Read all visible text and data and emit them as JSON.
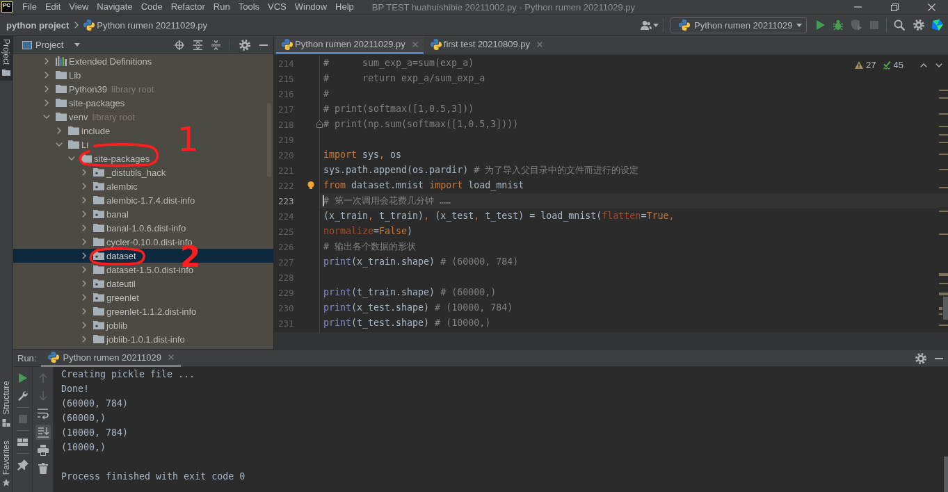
{
  "title_bar": {
    "logo": "PC",
    "menu": [
      "File",
      "Edit",
      "View",
      "Navigate",
      "Code",
      "Refactor",
      "Run",
      "Tools",
      "VCS",
      "Window",
      "Help"
    ],
    "title": "BP TEST huahuishibie 20211002.py - Python rumen 20211029.py"
  },
  "nav_bar": {
    "project": "python project",
    "file": "Python rumen 20211029.py",
    "run_config": "Python rumen 20211029",
    "stop": {
      "disabled": true
    }
  },
  "tool_strip": {
    "tabs": [
      {
        "label": "Project",
        "selected": true
      },
      {
        "label": "Structure",
        "selected": false
      },
      {
        "label": "Favorites",
        "selected": false
      }
    ]
  },
  "project_panel": {
    "title": "Project",
    "tree": [
      {
        "label": "Extended Definitions",
        "kind": "library",
        "expanded": false,
        "selected": false
      },
      {
        "label": "Lib",
        "kind": "folder",
        "expanded": false,
        "selected": false
      },
      {
        "label": "Python39",
        "note": "library root",
        "kind": "folder",
        "expanded": false,
        "selected": false
      },
      {
        "label": "site-packages",
        "kind": "folder",
        "expanded": false,
        "selected": false
      },
      {
        "label": "venv",
        "note": "library root",
        "kind": "folder",
        "expanded": true,
        "selected": false,
        "children": [
          {
            "label": "include",
            "kind": "folder",
            "expanded": false,
            "selected": false
          },
          {
            "label": "Li",
            "kind": "folder",
            "expanded": true,
            "selected": false,
            "children": [
              {
                "label": "site-packages",
                "kind": "folder",
                "expanded": true,
                "selected": false,
                "children": [
                  {
                    "label": "_distutils_hack",
                    "kind": "package",
                    "expanded": false,
                    "selected": false
                  },
                  {
                    "label": "alembic",
                    "kind": "package",
                    "expanded": false,
                    "selected": false
                  },
                  {
                    "label": "alembic-1.7.4.dist-info",
                    "kind": "folder",
                    "expanded": false,
                    "selected": false
                  },
                  {
                    "label": "banal",
                    "kind": "package",
                    "expanded": false,
                    "selected": false
                  },
                  {
                    "label": "banal-1.0.6.dist-info",
                    "kind": "folder",
                    "expanded": false,
                    "selected": false
                  },
                  {
                    "label": "cycler-0.10.0.dist-info",
                    "kind": "folder",
                    "expanded": false,
                    "selected": false
                  },
                  {
                    "label": "dataset",
                    "kind": "package",
                    "expanded": false,
                    "selected": true
                  },
                  {
                    "label": "dataset-1.5.0.dist-info",
                    "kind": "folder",
                    "expanded": false,
                    "selected": false
                  },
                  {
                    "label": "dateutil",
                    "kind": "package",
                    "expanded": false,
                    "selected": false
                  },
                  {
                    "label": "greenlet",
                    "kind": "package",
                    "expanded": false,
                    "selected": false
                  },
                  {
                    "label": "greenlet-1.1.2.dist-info",
                    "kind": "folder",
                    "expanded": false,
                    "selected": false
                  },
                  {
                    "label": "joblib",
                    "kind": "package",
                    "expanded": false,
                    "selected": false
                  },
                  {
                    "label": "joblib-1.0.1.dist-info",
                    "kind": "folder",
                    "expanded": false,
                    "selected": false
                  }
                ]
              }
            ]
          }
        ]
      }
    ]
  },
  "annotations": [
    {
      "label": "1"
    },
    {
      "label": "2"
    }
  ],
  "editor": {
    "tabs": [
      {
        "label": "Python rumen 20211029.py",
        "selected": true
      },
      {
        "label": "first test 20210809.py",
        "selected": false
      }
    ],
    "inspections": {
      "warnings": "27",
      "weak_warnings": "45"
    },
    "lines": [
      {
        "number": "214",
        "current": false,
        "fold_end": false,
        "bulb": false,
        "tokens": [
          {
            "kind": "comment",
            "text": "#      sum_exp_a=sum(exp_a)"
          }
        ]
      },
      {
        "number": "215",
        "current": false,
        "fold_end": false,
        "bulb": false,
        "tokens": [
          {
            "kind": "comment",
            "text": "#      return exp_a/sum_exp_a"
          }
        ]
      },
      {
        "number": "216",
        "current": false,
        "fold_end": false,
        "bulb": false,
        "tokens": [
          {
            "kind": "comment",
            "text": "#"
          }
        ]
      },
      {
        "number": "217",
        "current": false,
        "fold_end": false,
        "bulb": false,
        "tokens": [
          {
            "kind": "comment",
            "text": "# print(softmax([1,0.5,3]))"
          }
        ]
      },
      {
        "number": "218",
        "current": false,
        "fold_end": true,
        "bulb": false,
        "tokens": [
          {
            "kind": "comment",
            "text": "# print(np.sum(softmax([1,0.5,3])))"
          }
        ]
      },
      {
        "number": "219",
        "current": false,
        "fold_end": false,
        "bulb": false
      },
      {
        "number": "220",
        "current": false,
        "fold_end": false,
        "bulb": false,
        "tokens": [
          {
            "kind": "keyword",
            "text": "import"
          },
          {
            "kind": "plain",
            "text": " sys"
          },
          {
            "kind": "keyword",
            "text": ","
          },
          {
            "kind": "plain",
            "text": " os"
          }
        ]
      },
      {
        "number": "221",
        "current": false,
        "fold_end": false,
        "bulb": false,
        "tokens": [
          {
            "kind": "plain",
            "text": "sys.path.append(os.pardir)"
          },
          {
            "kind": "comment",
            "text": " # 为了导入父目录中的文件而进行的设定"
          }
        ]
      },
      {
        "number": "222",
        "current": false,
        "fold_end": false,
        "bulb": true,
        "tokens": [
          {
            "kind": "keyword",
            "text": "from"
          },
          {
            "kind": "plain",
            "text": " dataset.mnist "
          },
          {
            "kind": "keyword",
            "text": "import"
          },
          {
            "kind": "plain",
            "text": " load_mnist"
          }
        ]
      },
      {
        "number": "223",
        "current": true,
        "fold_end": false,
        "bulb": false,
        "tokens": [
          {
            "kind": "comment",
            "text": "# 第一次调用会花费几分钟 ……"
          }
        ]
      },
      {
        "number": "224",
        "current": false,
        "fold_end": false,
        "bulb": false,
        "tokens": [
          {
            "kind": "plain",
            "text": "(x_train"
          },
          {
            "kind": "keyword",
            "text": ","
          },
          {
            "kind": "plain",
            "text": " t_train)"
          },
          {
            "kind": "keyword",
            "text": ","
          },
          {
            "kind": "plain",
            "text": " (x_test"
          },
          {
            "kind": "keyword",
            "text": ","
          },
          {
            "kind": "plain",
            "text": " t_test) = load_mnist("
          },
          {
            "kind": "param",
            "text": "flatten"
          },
          {
            "kind": "plain",
            "text": "="
          },
          {
            "kind": "keyword",
            "text": "True,"
          }
        ]
      },
      {
        "number": "225",
        "current": false,
        "fold_end": false,
        "bulb": false,
        "tokens": [
          {
            "kind": "param",
            "text": "normalize"
          },
          {
            "kind": "plain",
            "text": "="
          },
          {
            "kind": "keyword",
            "text": "False"
          },
          {
            "kind": "plain",
            "text": ")"
          }
        ]
      },
      {
        "number": "226",
        "current": false,
        "fold_end": false,
        "bulb": false,
        "tokens": [
          {
            "kind": "comment",
            "text": "# 输出各个数据的形状"
          }
        ]
      },
      {
        "number": "227",
        "current": false,
        "fold_end": false,
        "bulb": false,
        "tokens": [
          {
            "kind": "builtin",
            "text": "print"
          },
          {
            "kind": "plain",
            "text": "(x_train.shape)"
          },
          {
            "kind": "comment",
            "text": " # (60000, 784)"
          }
        ]
      },
      {
        "number": "228",
        "current": false,
        "fold_end": false,
        "bulb": false
      },
      {
        "number": "229",
        "current": false,
        "fold_end": false,
        "bulb": false,
        "tokens": [
          {
            "kind": "builtin",
            "text": "print"
          },
          {
            "kind": "plain",
            "text": "(t_train.shape)"
          },
          {
            "kind": "comment",
            "text": " # (60000,)"
          }
        ]
      },
      {
        "number": "230",
        "current": false,
        "fold_end": false,
        "bulb": false,
        "tokens": [
          {
            "kind": "builtin",
            "text": "print"
          },
          {
            "kind": "plain",
            "text": "(x_test.shape)"
          },
          {
            "kind": "comment",
            "text": " # (10000, 784)"
          }
        ]
      },
      {
        "number": "231",
        "current": false,
        "fold_end": false,
        "bulb": false,
        "tokens": [
          {
            "kind": "builtin",
            "text": "print"
          },
          {
            "kind": "plain",
            "text": "(t_test.shape)"
          },
          {
            "kind": "comment",
            "text": " # (10000,)"
          }
        ]
      }
    ]
  },
  "run_panel": {
    "title": "Run:",
    "tabs": [
      {
        "label": "Python rumen 20211029",
        "selected": true
      }
    ],
    "toolbar": {
      "stop": {
        "disabled": true
      },
      "previous": {
        "disabled": true
      },
      "next": {
        "disabled": true
      },
      "soft_wrap": {
        "on": false
      },
      "scroll_to_end": {
        "on": true
      }
    },
    "output": [
      {
        "kind": "stdout",
        "text": "Creating pickle file ..."
      },
      {
        "kind": "stdout",
        "text": "Done!"
      },
      {
        "kind": "stdout",
        "text": "(60000, 784)"
      },
      {
        "kind": "stdout",
        "text": "(60000,)"
      },
      {
        "kind": "stdout",
        "text": "(10000, 784)"
      },
      {
        "kind": "stdout",
        "text": "(10000,)"
      },
      {
        "kind": "system",
        "text": "Process finished with exit code 0"
      }
    ]
  }
}
